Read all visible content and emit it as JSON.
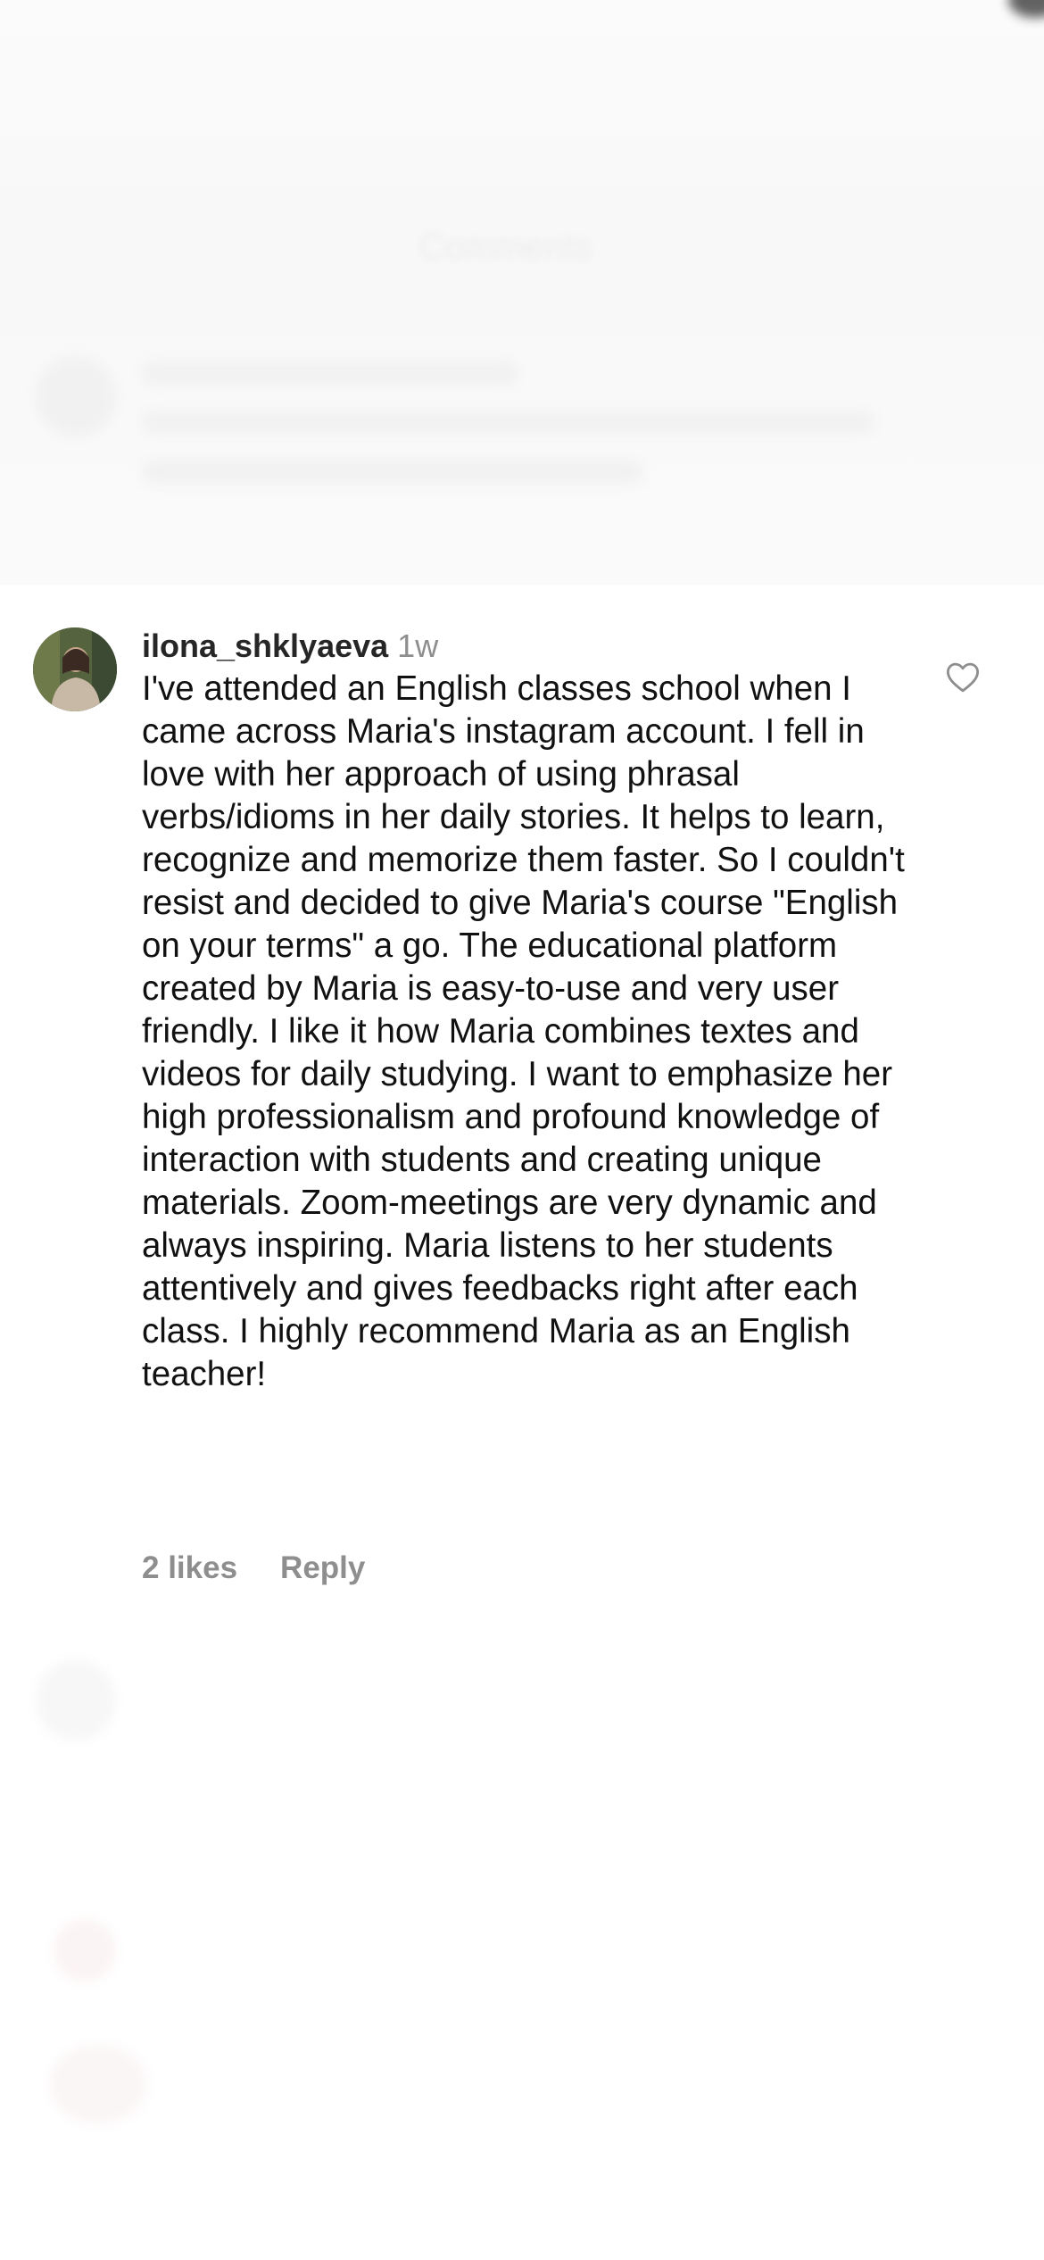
{
  "background": {
    "sheet_title": "Comments"
  },
  "comment": {
    "username": "ilona_shklyaeva",
    "timestamp": "1w",
    "text": "I've attended an English classes school when I came across Maria's instagram account. I fell in love with her approach of using phrasal verbs/idioms in her daily stories. It helps to learn, recognize and memorize them faster. So I couldn't resist and decided to give Maria's course \"English on your terms\" a go. The educational platform created by Maria is easy-to-use and very user friendly. I like it how Maria combines textes and videos for daily studying. I want to emphasize her high professionalism and profound knowledge of interaction with students and creating unique materials. Zoom-meetings are very dynamic and always inspiring. Maria listens to her students attentively and gives feedbacks right after each class. I highly recommend Maria as an English teacher!",
    "likes_label": "2 likes",
    "reply_label": "Reply",
    "like_icon": "heart-outline-icon"
  },
  "colors": {
    "text_primary": "#111111",
    "text_secondary": "#8e8e8e",
    "background": "#ffffff"
  }
}
